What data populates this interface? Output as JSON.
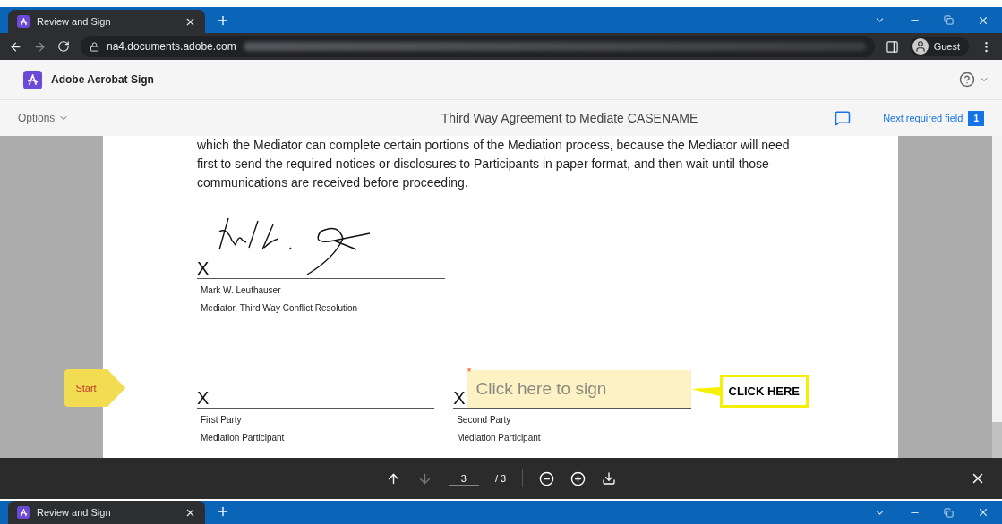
{
  "browser": {
    "tabs": [
      {
        "title": "Review and Sign",
        "selected": true
      }
    ],
    "url_host": "na4.documents.adobe.com",
    "profile": "Guest"
  },
  "app": {
    "name": "Adobe Acrobat Sign"
  },
  "toolbar": {
    "options": "Options",
    "title": "Third Way Agreement to Mediate CASENAME",
    "next_field": "Next required field",
    "required_count": "1"
  },
  "document": {
    "paragraph": "which the Mediator can complete certain portions of the Mediation process, because the Mediator will need first to send the required notices or disclosures to Participants in paper format, and then wait until those communications are received before proceeding.",
    "signatures": [
      {
        "kind": "signed",
        "mark": "X",
        "lines": [
          "Mark W. Leuthauser",
          "Mediator, Third Way Conflict Resolution"
        ]
      },
      {
        "kind": "blank",
        "mark": "X",
        "lines": [
          "First Party",
          "Mediation Participant"
        ]
      },
      {
        "kind": "field",
        "mark": "X",
        "placeholder": "Click here to sign",
        "required": true,
        "required_mark": "*",
        "lines": [
          "Second Party",
          "Mediation Participant"
        ]
      }
    ],
    "start_tag": "Start",
    "callout": "CLICK HERE"
  },
  "page_nav": {
    "current": "3",
    "total": "/ 3"
  },
  "second_window": {
    "tabs": [
      {
        "title": "Review and Sign",
        "selected": true
      }
    ]
  }
}
